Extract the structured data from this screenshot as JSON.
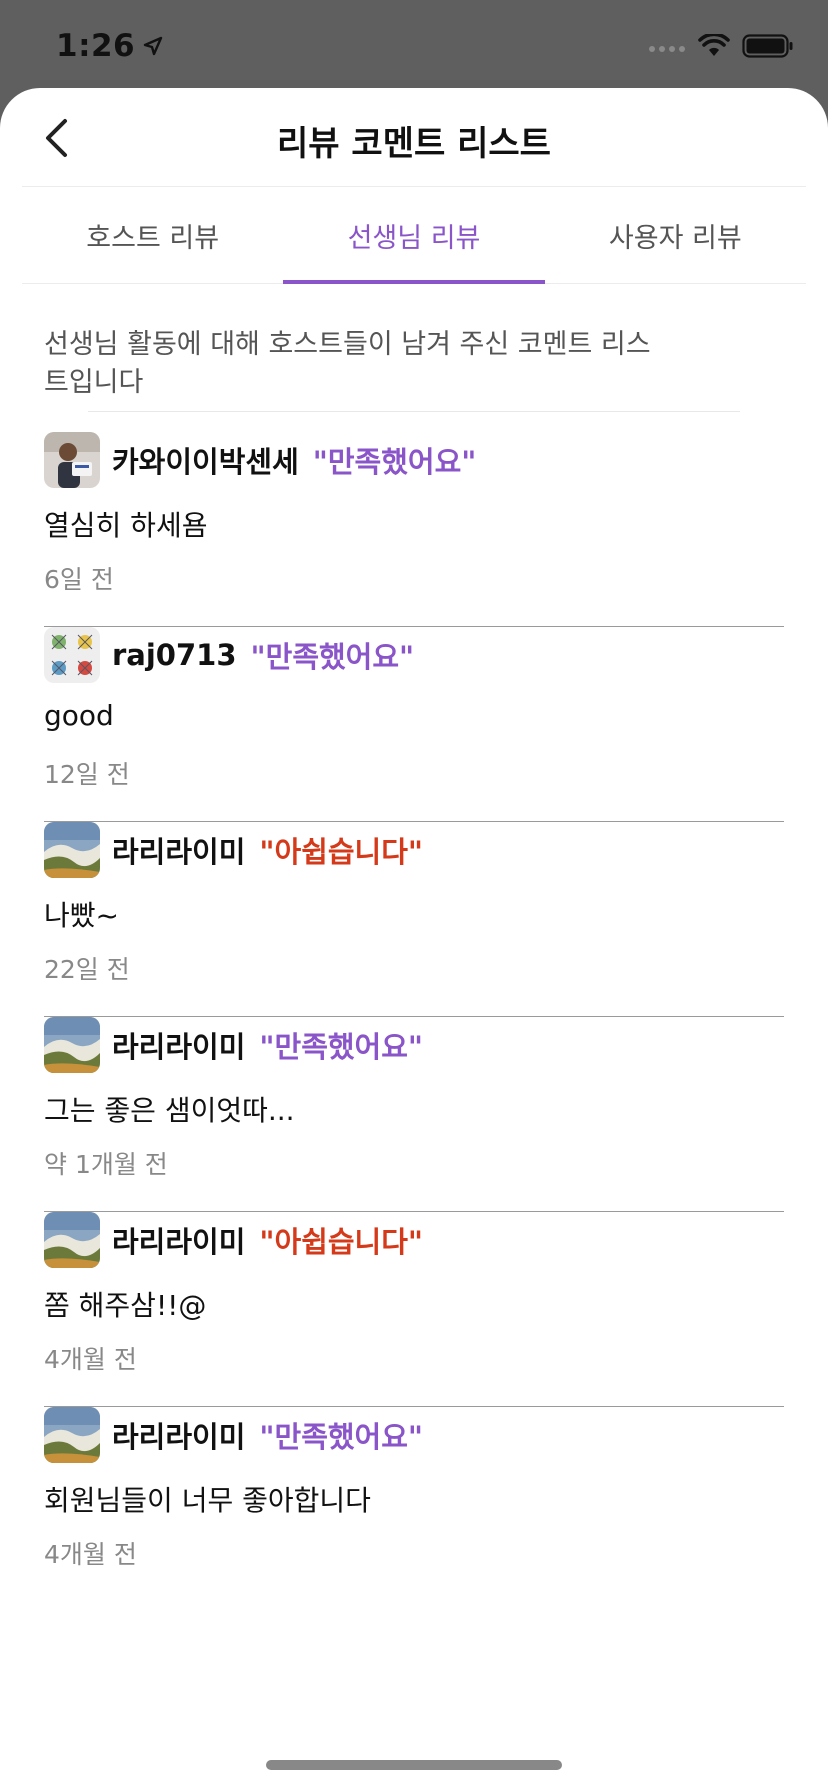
{
  "status_bar": {
    "time": "1:26",
    "location_icon": "location-arrow-icon",
    "signal_icon": "cellular-signal-icon",
    "wifi_icon": "wifi-icon",
    "battery_icon": "battery-icon"
  },
  "header": {
    "title": "리뷰 코멘트 리스트",
    "back_icon": "chevron-left-icon"
  },
  "tabs": [
    {
      "label": "호스트 리뷰",
      "active": false
    },
    {
      "label": "선생님 리뷰",
      "active": true
    },
    {
      "label": "사용자 리뷰",
      "active": false
    }
  ],
  "description": "선생님 활동에 대해 호스트들이 남겨 주신 코멘트 리스트입니다",
  "reviews": [
    {
      "user": "카와이이박센세",
      "rating": "\"만족했어요\"",
      "rating_type": "good",
      "comment": "열심히 하세욤",
      "time": "6일 전",
      "avatar": "person-photo"
    },
    {
      "user": "raj0713",
      "rating": "\"만족했어요\"",
      "rating_type": "good",
      "comment": "good",
      "time": "12일 전",
      "avatar": "bugs-illustration"
    },
    {
      "user": "라리라이미",
      "rating": "\"아쉽습니다\"",
      "rating_type": "bad",
      "comment": "나빴~",
      "time": "22일 전",
      "avatar": "landscape-photo"
    },
    {
      "user": "라리라이미",
      "rating": "\"만족했어요\"",
      "rating_type": "good",
      "comment": "그는 좋은 샘이엇따...",
      "time": "약 1개월 전",
      "avatar": "landscape-photo"
    },
    {
      "user": "라리라이미",
      "rating": "\"아쉽습니다\"",
      "rating_type": "bad",
      "comment": "쫌 해주삼!!@",
      "time": "4개월 전",
      "avatar": "landscape-photo"
    },
    {
      "user": "라리라이미",
      "rating": "\"만족했어요\"",
      "rating_type": "good",
      "comment": "회원님들이 너무 좋아합니다",
      "time": "4개월 전",
      "avatar": "landscape-photo"
    }
  ],
  "colors": {
    "accent": "#8a55c8",
    "negative": "#d43a1a"
  }
}
